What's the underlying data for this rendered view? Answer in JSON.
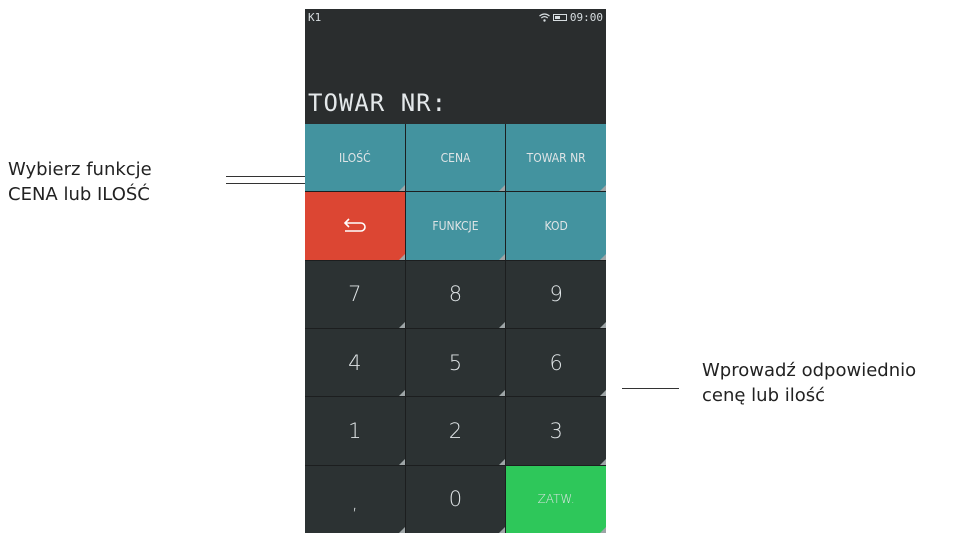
{
  "callouts": {
    "left": {
      "line1": "Wybierz funkcje",
      "line2": "CENA lub ILOŚĆ"
    },
    "right": {
      "line1": "Wprowadź odpowiednio",
      "line2": "cenę lub ilość"
    }
  },
  "device": {
    "status": {
      "left": "K1",
      "time": "09:00",
      "wifi_icon": "wifi-icon",
      "battery_icon": "battery-icon"
    },
    "display_text": "TOWAR NR:",
    "keys": {
      "ilosc": "ILOŚĆ",
      "cena": "CENA",
      "towar_nr": "TOWAR NR",
      "back_icon": "↩",
      "funkcje": "FUNKCJE",
      "kod": "KOD",
      "k7": "7",
      "k8": "8",
      "k9": "9",
      "k4": "4",
      "k5": "5",
      "k6": "6",
      "k1": "1",
      "k2": "2",
      "k3": "3",
      "comma": ",",
      "k0": "0",
      "zatw": "ZATW."
    },
    "colors": {
      "function_key": "#43939f",
      "back_key": "#dc4633",
      "confirm_key": "#2ec75a",
      "background": "#2a2d2e"
    }
  }
}
